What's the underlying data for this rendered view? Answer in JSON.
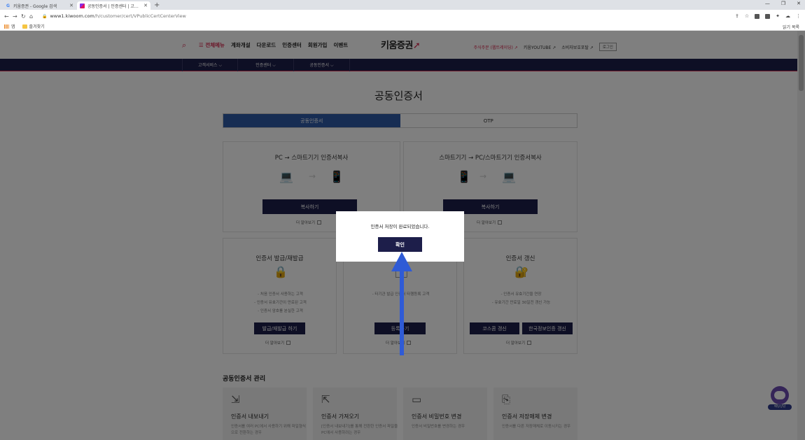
{
  "browser": {
    "tabs": [
      {
        "title": "키움증권 - Google 검색",
        "active": false
      },
      {
        "title": "공동인증서 | 인증센터 | 고객서...",
        "active": true
      }
    ],
    "new_tab": "+",
    "url_host": "www1.kiwoom.com",
    "url_path": "/h/customer/cert/VPublicCertCenterView",
    "bookmarks": [
      {
        "label": "앱"
      },
      {
        "label": "즐겨찾기"
      }
    ],
    "reading_list": "읽기 목록"
  },
  "header": {
    "all_menu": "전체메뉴",
    "gnb": [
      "계좌개설",
      "다운로드",
      "인증센터",
      "회원가입",
      "이벤트"
    ],
    "logo": "키움증권",
    "util": [
      "주식주문 (웹트레이딩) ↗",
      "키움YOUTUBE ↗",
      "소비자보호포탈 ↗"
    ],
    "login": "로그인"
  },
  "subnav": [
    "고객서비스 ⌵",
    "인증센터 ⌵",
    "공동인증서 ⌵"
  ],
  "page_title": "공동인증서",
  "tabs": [
    "공동인증서",
    "OTP"
  ],
  "copy_boxes": [
    {
      "title": "PC → 스마트기기 인증서복사",
      "button": "복사하기",
      "more": "더 알아보기"
    },
    {
      "title": "스마트기기 → PC/스마트기기 인증서복사",
      "button": "복사하기",
      "more": "더 알아보기"
    }
  ],
  "cert_boxes": [
    {
      "title": "인증서 발급/재발급",
      "bullets": [
        "- 처음 인증서 사용하는 고객",
        "- 인증서 유효기간이 만료된 고객",
        "- 인증서 암호를 분실한 고객"
      ],
      "buttons": [
        "발급/재발급 하기"
      ],
      "more": "더 알아보기"
    },
    {
      "title": "",
      "bullets": [
        "- 타기관 발급 인증서 타행등록 고객"
      ],
      "buttons": [
        "등록하기"
      ],
      "more": "더 알아보기"
    },
    {
      "title": "인증서 갱신",
      "bullets": [
        "- 인증서 유효기간을 연장",
        "- 유효기간 만료일 30일전 갱신 가능"
      ],
      "buttons": [
        "코스콤 갱신",
        "한국정보인증 갱신"
      ],
      "more": "더 알아보기"
    }
  ],
  "management": {
    "title": "공동인증서 관리",
    "cards": [
      {
        "title": "인증서 내보내기",
        "desc": "인증서를 여러 PC에서 사용하기 위해 파일형식으로 전환하는 경우"
      },
      {
        "title": "인증서 가져오기",
        "desc": "[인증서 내보내기]를 통해 전환한 인증서 파일을 PC에서 사용하려는 경우"
      },
      {
        "title": "인증서 비밀번호 변경",
        "desc": "인증서 비밀번호를 변경하는 경우"
      },
      {
        "title": "인증서 저장매체 변경",
        "desc": "인증서를 다른 저장매체로 이동시키는 경우"
      }
    ]
  },
  "chatbot": "채팅상담",
  "modal": {
    "message": "인증서 저장이 완료되었습니다.",
    "ok": "확인"
  },
  "colors": {
    "brand": "#d6284e",
    "navy": "#1d1e4a",
    "tab_active": "#2e5ba6",
    "arrow": "#2f5bd6"
  }
}
